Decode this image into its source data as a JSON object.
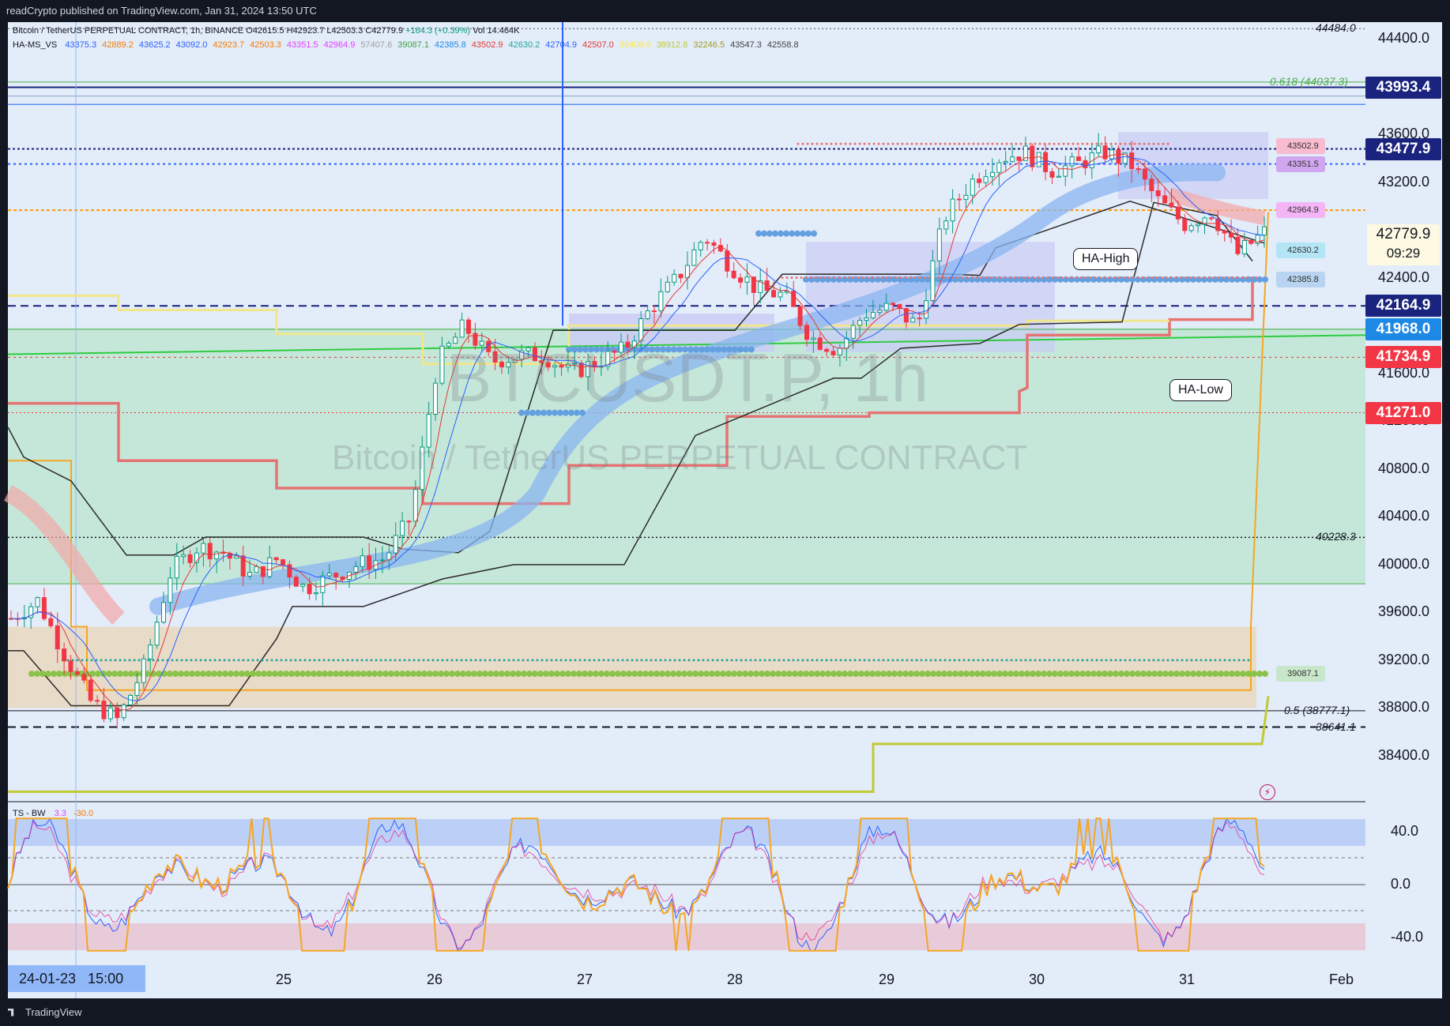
{
  "header": {
    "publish_line": "readCrypto published on TradingView.com, Jan 31, 2024 13:50 UTC"
  },
  "legend": {
    "title_line": "Bitcoin / TetherUS PERPETUAL CONTRACT, 1h, BINANCE",
    "ohlc": [
      "O42615.5",
      "H42923.7",
      "L42503.3",
      "C42779.9",
      "+164.3 (+0.39%)",
      "Vol 14.464K"
    ],
    "indicator_name": "HA-MS_VS",
    "indicator_values": [
      "43375.3",
      "42889.2",
      "43625.2",
      "43092.0",
      "42923.7",
      "42503.3",
      "43351.5",
      "42964.9",
      "57407.6",
      "39087.1",
      "42385.8",
      "43502.9",
      "42630.2",
      "42704.9",
      "42507.0",
      "39406.9",
      "38912.8",
      "32246.5",
      "43547.3",
      "42558.8"
    ],
    "indicator_colors": [
      "#2962ff",
      "#f57c00",
      "#2962ff",
      "#2962ff",
      "#f57c00",
      "#f57c00",
      "#e040fb",
      "#e040fb",
      "#9e9e9e",
      "#43a047",
      "#1e88e5",
      "#e53935",
      "#26a69a",
      "#2962ff",
      "#e53935",
      "#ffeb3b",
      "#c0ca33",
      "#9e9d24",
      "#424242",
      "#424242"
    ]
  },
  "watermark": {
    "symbol": "BTCUSDT.P, 1h",
    "name": "Bitcoin / TetherUS PERPETUAL CONTRACT"
  },
  "price_axis": {
    "ticks": [
      "44400.0",
      "43600.0",
      "43200.0",
      "42400.0",
      "41600.0",
      "41200.0",
      "40800.0",
      "40400.0",
      "40000.0",
      "39600.0",
      "39200.0",
      "38800.0",
      "38400.0"
    ],
    "current_price": "42779.9",
    "countdown": "09:29",
    "tags": [
      {
        "label": "43993.4",
        "color": "#1a237e"
      },
      {
        "label": "43477.9",
        "color": "#1a237e"
      },
      {
        "label": "42164.9",
        "color": "#1a237e"
      },
      {
        "label": "41968.0",
        "color": "#1e88e5"
      },
      {
        "label": "41734.9",
        "color": "#f23645"
      },
      {
        "label": "41271.0",
        "color": "#f23645"
      }
    ]
  },
  "level_labels": {
    "top": "44484.0",
    "fib_618": "0.618 (44037.3)",
    "mid": "40228.3",
    "fib_05": "0.5 (38777.1)",
    "low": "38641.1"
  },
  "mini_tags": [
    {
      "label": "43502.9",
      "color": "#f8bbd0"
    },
    {
      "label": "43351.5",
      "color": "#d1a6f0"
    },
    {
      "label": "42964.9",
      "color": "#f3b5f5"
    },
    {
      "label": "42630.2",
      "color": "#b3e5f5"
    },
    {
      "label": "42385.8",
      "color": "#b8d4f0"
    },
    {
      "label": "39087.1",
      "color": "#c8e6c9"
    }
  ],
  "callouts": {
    "high": "HA-High",
    "low": "HA-Low"
  },
  "oscillator": {
    "name": "TS - BW",
    "value1": "3.3",
    "value2": "-30.0",
    "ticks": [
      "40.0",
      "0.0",
      "-40.0"
    ]
  },
  "time_axis": {
    "cursor_label": "24-01-23   15:00",
    "days": [
      "25",
      "26",
      "27",
      "28",
      "29",
      "30",
      "31",
      "Feb"
    ]
  },
  "footer": {
    "brand": "TradingView"
  },
  "chart_data": {
    "type": "candlestick",
    "symbol": "BTCUSDT.P",
    "timeframe": "1h",
    "ylim": [
      38100,
      44700
    ],
    "x": [
      "Jan 24",
      "Jan 25",
      "Jan 26",
      "Jan 27",
      "Jan 28",
      "Jan 29",
      "Jan 30",
      "Jan 31"
    ],
    "close_path": [
      39550,
      39700,
      39250,
      38850,
      38700,
      39150,
      39950,
      40150,
      40100,
      39900,
      40050,
      39800,
      39900,
      40000,
      40050,
      40400,
      41700,
      42000,
      41700,
      41750,
      41750,
      41600,
      41700,
      41800,
      42150,
      42400,
      42750,
      42500,
      42300,
      42250,
      41900,
      41800,
      42100,
      42150,
      42000,
      42900,
      43200,
      43400,
      43450,
      43300,
      43350,
      43450,
      43350,
      43050,
      42850,
      42950,
      42600,
      42780
    ],
    "last_close": 42779.9,
    "levels": [
      44484.0,
      44037.3,
      43993.4,
      43477.9,
      42164.9,
      41968.0,
      41734.9,
      41271.0,
      40228.3,
      38777.1,
      38641.1
    ],
    "oscillator_range": [
      -60,
      60
    ]
  }
}
